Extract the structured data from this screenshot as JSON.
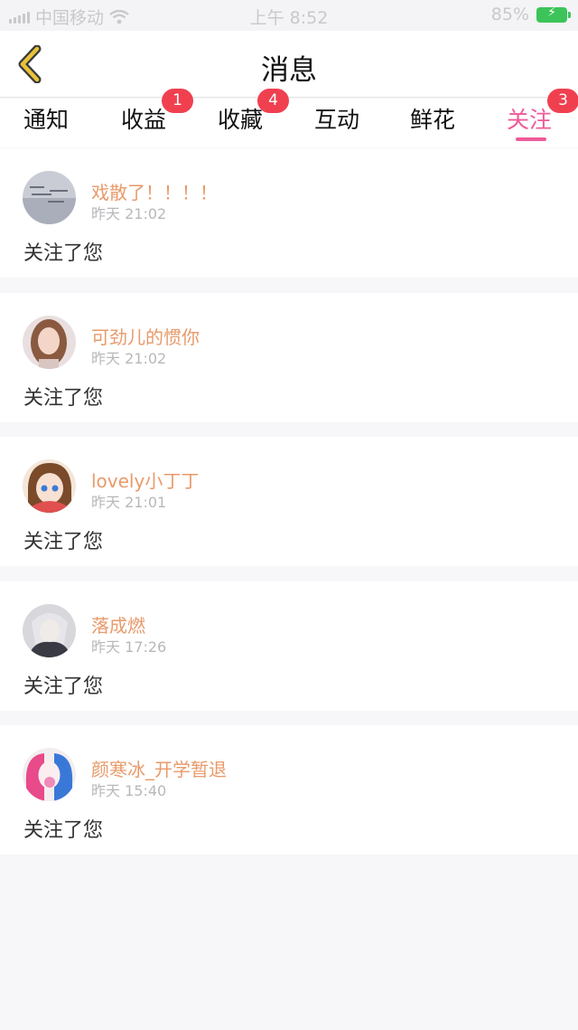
{
  "status_bar": {
    "carrier": "中国移动",
    "time": "上午 8:52",
    "battery_percent": "85%",
    "icons": [
      "signal-icon",
      "wifi-icon",
      "battery-icon"
    ]
  },
  "nav": {
    "title": "消息",
    "back_icon": "chevron-left-icon"
  },
  "tabs": [
    {
      "label": "通知",
      "badge": ""
    },
    {
      "label": "收益",
      "badge": "1"
    },
    {
      "label": "收藏",
      "badge": "4"
    },
    {
      "label": "互动",
      "badge": ""
    },
    {
      "label": "鲜花",
      "badge": ""
    },
    {
      "label": "关注",
      "badge": "3",
      "active": true
    }
  ],
  "notifications": [
    {
      "username": "戏散了！！！！",
      "time": "昨天 21:02",
      "message": "关注了您"
    },
    {
      "username": "可劲儿的惯你",
      "time": "昨天 21:02",
      "message": "关注了您"
    },
    {
      "username": "lovely小丁丁",
      "time": "昨天 21:01",
      "message": "关注了您"
    },
    {
      "username": "落成燃",
      "time": "昨天 17:26",
      "message": "关注了您"
    },
    {
      "username": "颜寒冰_开学暂退",
      "time": "昨天 15:40",
      "message": "关注了您"
    }
  ],
  "colors": {
    "accent": "#ee5b9a",
    "username": "#e89a6a",
    "badge": "#f04050",
    "back_icon": "#e8c33a"
  }
}
